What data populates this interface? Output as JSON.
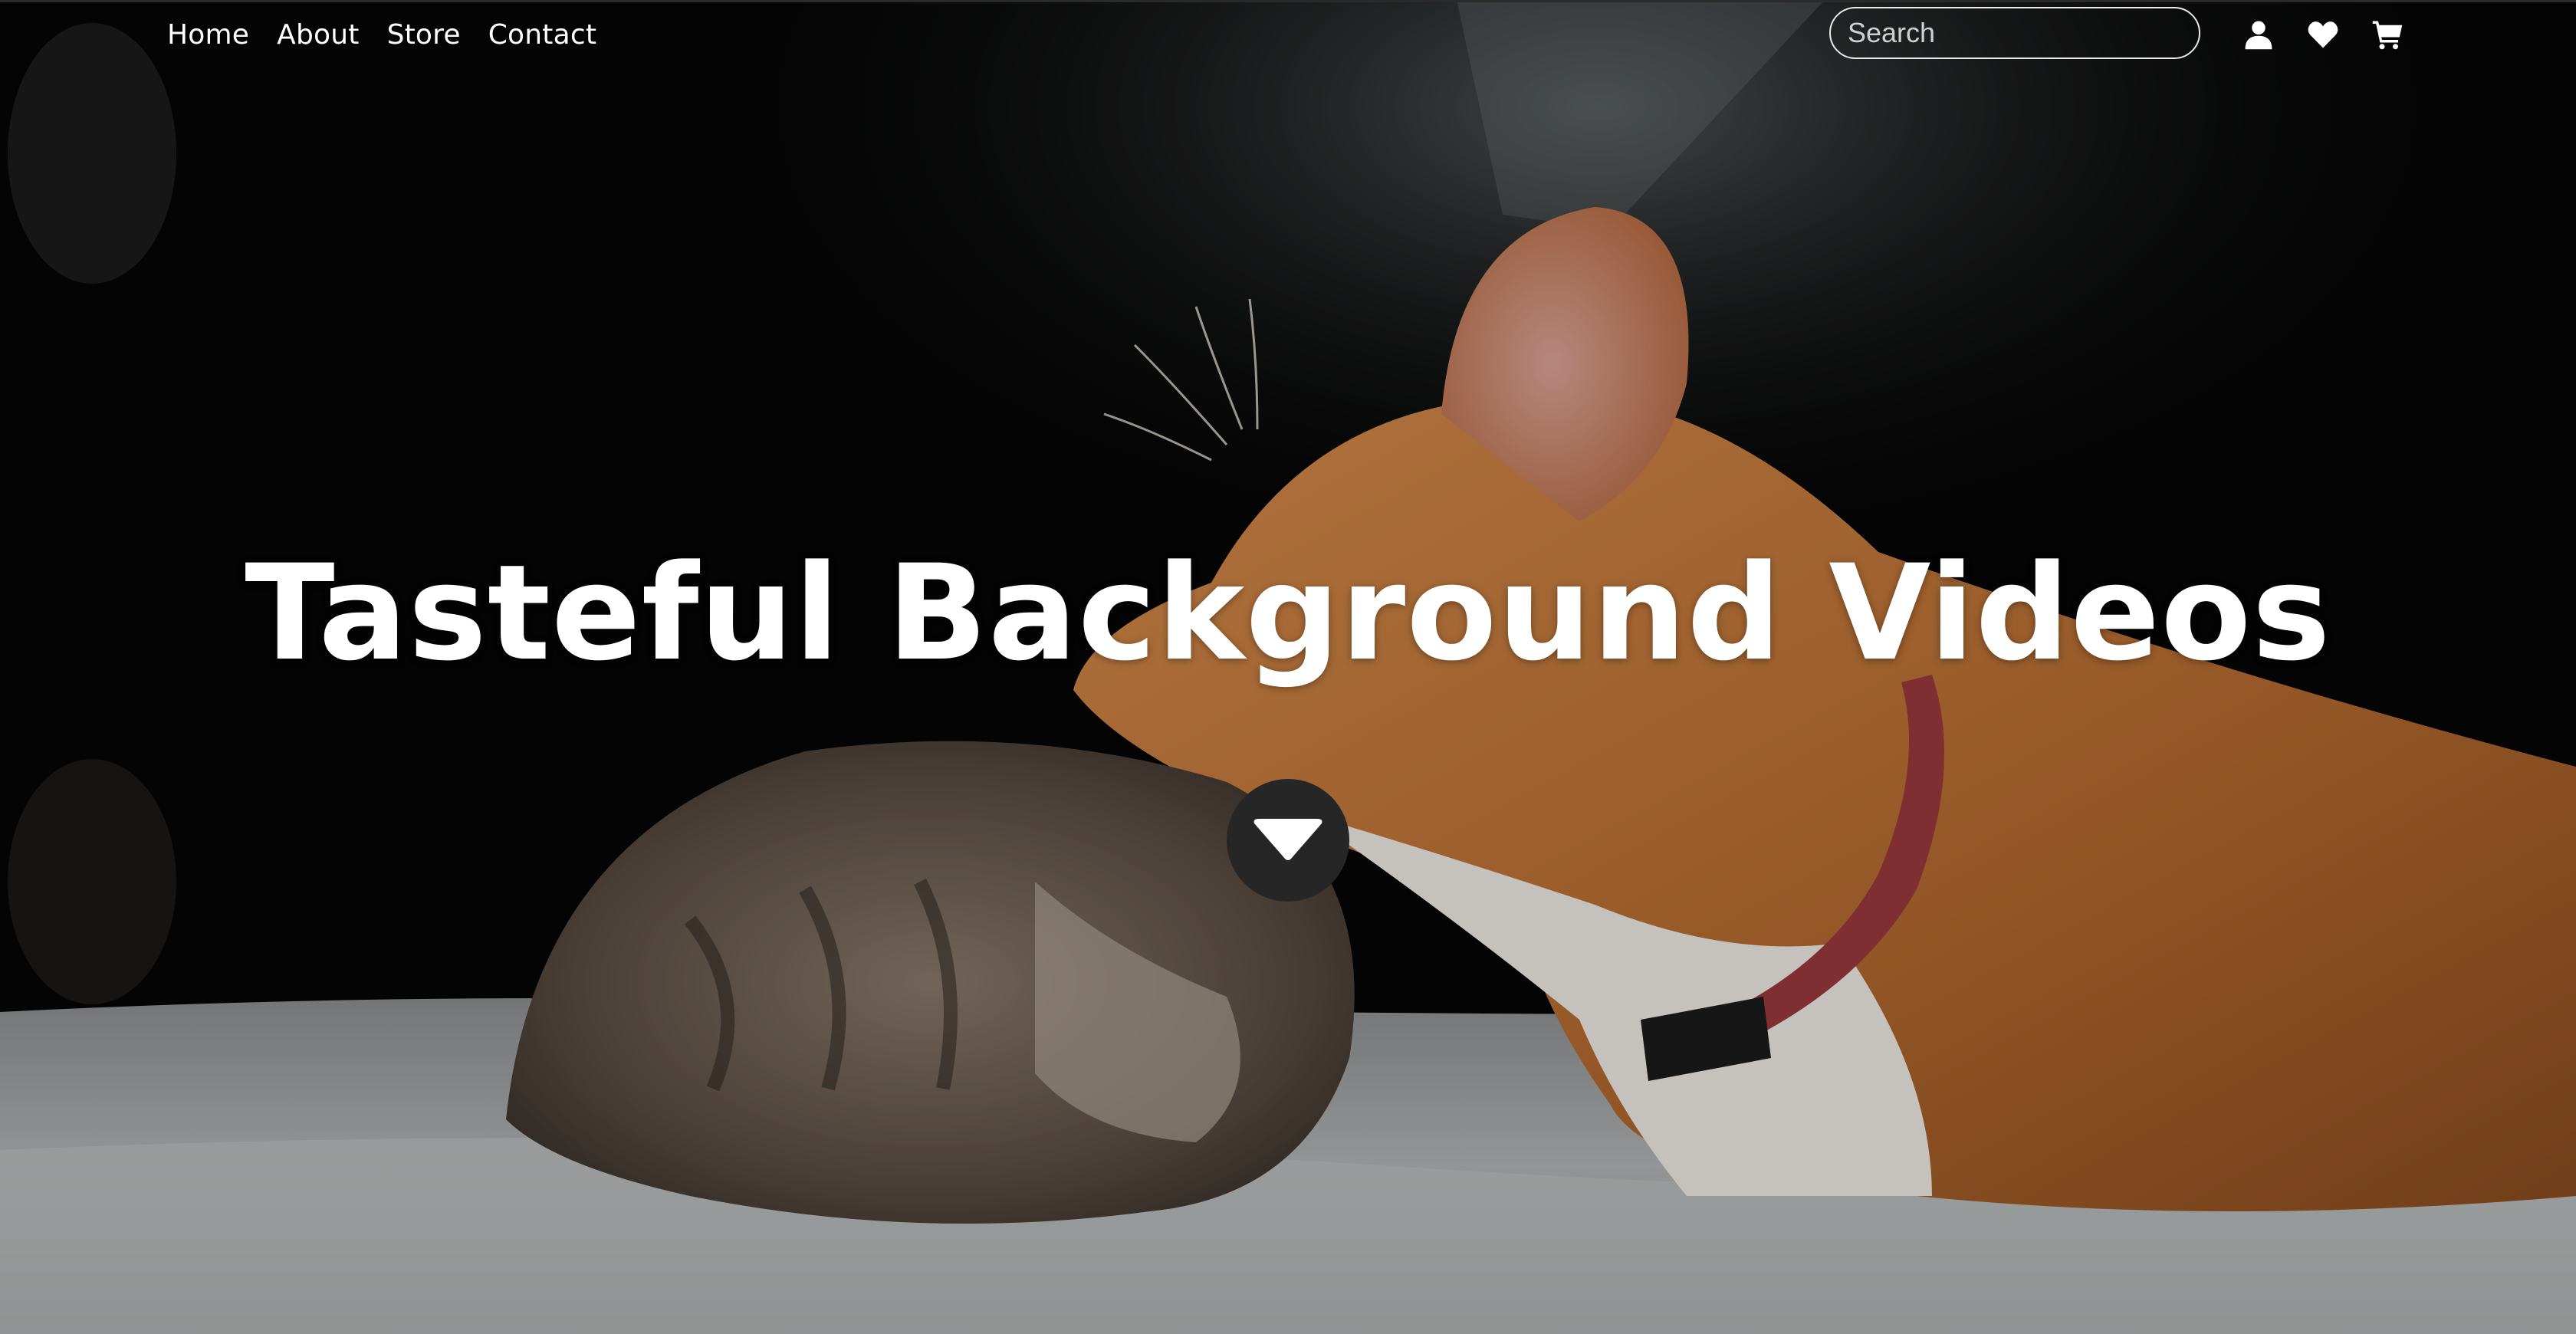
{
  "nav": {
    "items": [
      {
        "label": "Home"
      },
      {
        "label": "About"
      },
      {
        "label": "Store"
      },
      {
        "label": "Contact"
      }
    ]
  },
  "search": {
    "placeholder": "Search",
    "button_icon": "search-icon"
  },
  "header_icons": [
    "user-icon",
    "heart-icon",
    "cart-icon"
  ],
  "hero": {
    "title": "Tasteful Background Videos",
    "scroll_icon": "chevron-down-icon",
    "background": "video of an orange cat and a tabby kitten on a white rug"
  },
  "colors": {
    "text": "#ffffff",
    "scroll_button": "#262626",
    "search_border": "#e9e9e9"
  }
}
